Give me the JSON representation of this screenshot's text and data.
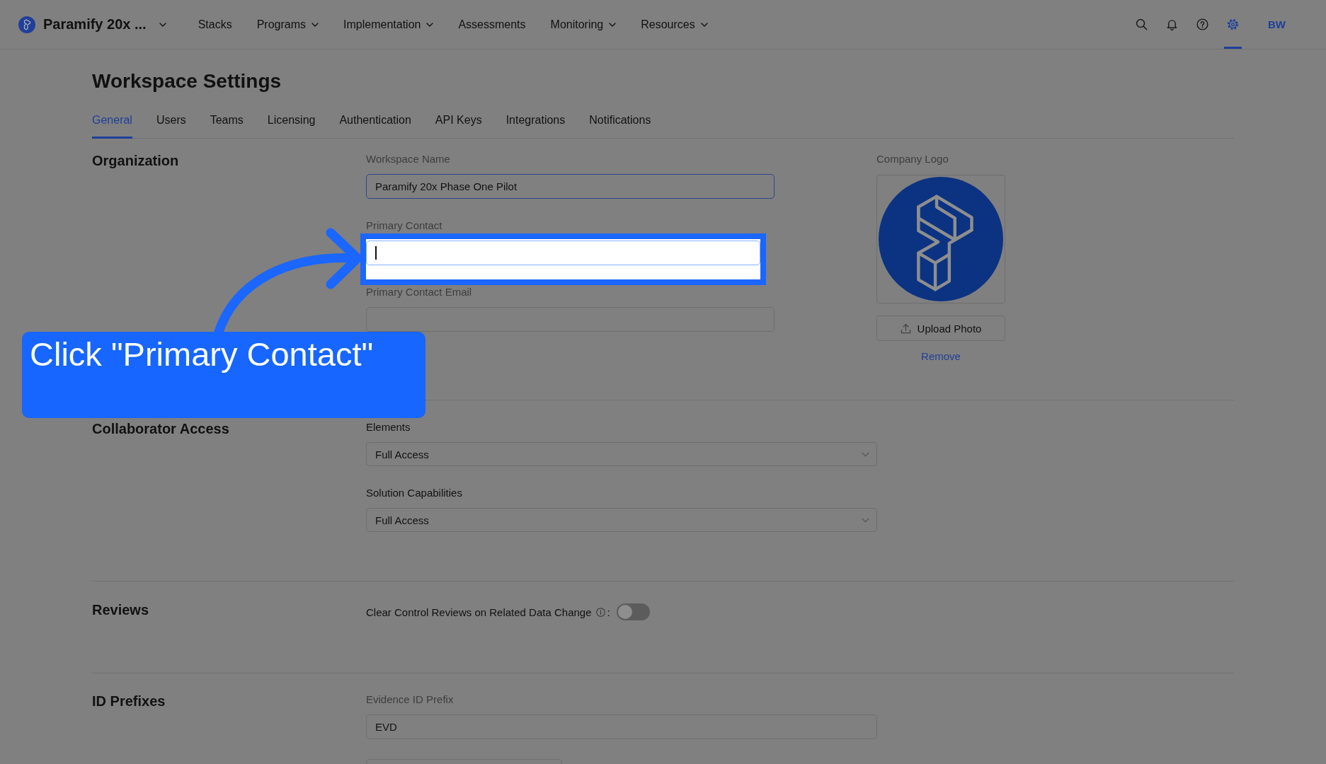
{
  "top_nav": {
    "workspace_name": "Paramify 20x ...",
    "items": [
      {
        "label": "Stacks",
        "has_menu": false
      },
      {
        "label": "Programs",
        "has_menu": true
      },
      {
        "label": "Implementation",
        "has_menu": true
      },
      {
        "label": "Assessments",
        "has_menu": false
      },
      {
        "label": "Monitoring",
        "has_menu": true
      },
      {
        "label": "Resources",
        "has_menu": true
      }
    ],
    "icon_buttons": [
      {
        "kind": "search",
        "selected": false
      },
      {
        "kind": "notifications",
        "selected": false
      },
      {
        "kind": "help",
        "selected": false
      },
      {
        "kind": "settings",
        "selected": true
      }
    ],
    "user_initials": "BW"
  },
  "page_title": "Workspace Settings",
  "tabs": [
    {
      "label": "General",
      "selected": true
    },
    {
      "label": "Users",
      "selected": false
    },
    {
      "label": "Teams",
      "selected": false
    },
    {
      "label": "Licensing",
      "selected": false
    },
    {
      "label": "Authentication",
      "selected": false
    },
    {
      "label": "API Keys",
      "selected": false
    },
    {
      "label": "Integrations",
      "selected": false
    },
    {
      "label": "Notifications",
      "selected": false
    }
  ],
  "sections": [
    {
      "kind": "organization",
      "title": "Organization",
      "fields": [
        {
          "kind": "input",
          "label": "Workspace Name",
          "value": "Paramify 20x Phase One Pilot",
          "focused": true,
          "highlighted": false
        },
        {
          "kind": "input",
          "label": "Primary Contact",
          "focused": true,
          "highlighted": true
        },
        {
          "kind": "input",
          "label": "Primary Contact Email",
          "focused": false,
          "highlighted": false
        }
      ],
      "company_logo": {
        "label": "Company Logo",
        "upload_button": "Upload Photo",
        "remove_link": "Remove"
      }
    },
    {
      "kind": "collaborator",
      "title": "Collaborator Access",
      "fields": [
        {
          "kind": "select",
          "label": "Elements",
          "value": "Full Access"
        },
        {
          "kind": "select",
          "label": "Solution Capabilities",
          "value": "Full Access"
        }
      ]
    },
    {
      "kind": "reviews",
      "title": "Reviews",
      "toggle": {
        "label": "Clear Control Reviews on Related Data Change",
        "suffix": ":",
        "on": false
      }
    },
    {
      "kind": "id_prefixes",
      "title": "ID Prefixes",
      "fields": [
        {
          "kind": "input",
          "label": "Evidence ID Prefix",
          "value": "EVD",
          "focused": false
        },
        {
          "kind": "input_narrow",
          "focused": false
        }
      ]
    }
  ],
  "tutorial": {
    "callout": "Click \"Primary Contact\""
  }
}
